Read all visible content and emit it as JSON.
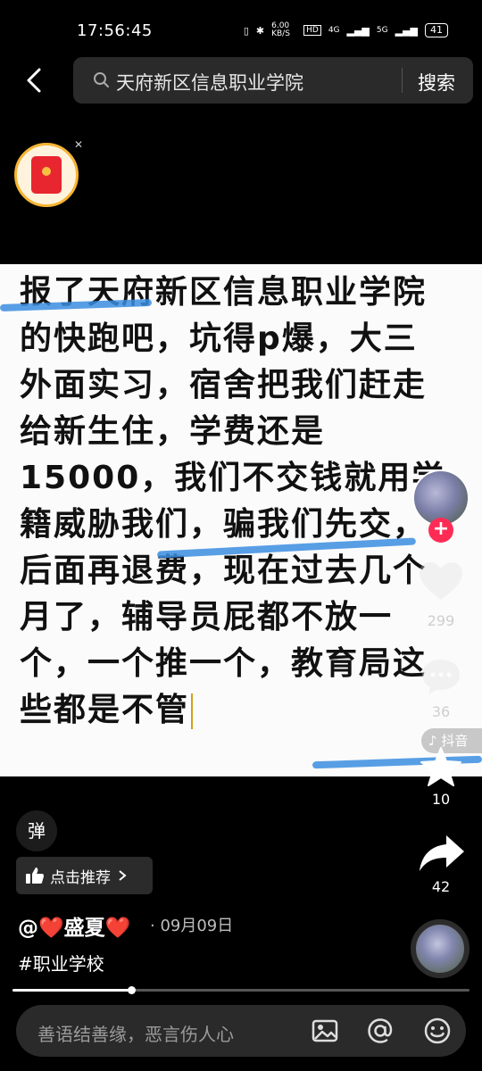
{
  "status_bar": {
    "time": "17:56:45",
    "net_speed": "6.00 KB/S",
    "hd": "HD",
    "sig1": "4G",
    "sig2": "5G",
    "battery": "41"
  },
  "header": {
    "search_query": "天府新区信息职业学院",
    "search_button": "搜索"
  },
  "video": {
    "text_lines": [
      "报了天府新区信息职业学院",
      "的快跑吧，坑得p爆，大三",
      "外面实习，宿舍把我们赶走",
      "给新生住，学费还是",
      "15000，我们不交钱就用学",
      "籍威胁我们，骗我们先交，",
      "后面再退费，现在过去几个",
      "月了，辅导员屁都不放一",
      "个，一个推一个，教育局这",
      "些都是不管"
    ],
    "watermark": "抖音"
  },
  "sidebar": {
    "like_count": "299",
    "comment_count": "36",
    "favorite_count": "10",
    "share_count": "42"
  },
  "info": {
    "danmu_label": "弹",
    "recommend_label": "点击推荐",
    "author": "@❤️盛夏❤️",
    "date": "· 09月09日",
    "hashtag": "#职业学校"
  },
  "progress": 0.26,
  "comment": {
    "placeholder": "善语结善缘，恶言伤人心"
  },
  "colors": {
    "accent_red": "#fe2c55",
    "scribble_blue": "#3b8de0"
  }
}
